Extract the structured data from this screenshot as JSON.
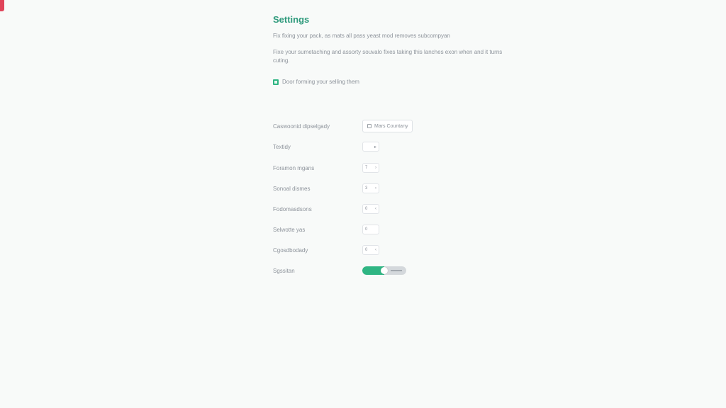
{
  "app": {
    "title": "Settings",
    "accent_color": "#2fb583",
    "title_color": "#2e9a7c"
  },
  "intro": {
    "line1": "Fix fixing your pack, as mats all pass yeast mod removes subcompyan",
    "line2": "Fixe your sumetaching and assorty souvalo fixes taking this lanches exon when and it turns cuting."
  },
  "checkbox": {
    "label": "Door forming your selling them",
    "checked": true
  },
  "rows": [
    {
      "label": "Caswoonid dipselgady",
      "control": "select-button",
      "value": "Mars Countany",
      "icon": "square-icon"
    },
    {
      "label": "Textidy",
      "control": "stepper",
      "value": "",
      "arrow": "▸"
    },
    {
      "label": "Foramon mgans",
      "control": "stepper",
      "value": "7",
      "arrow": "›"
    },
    {
      "label": "Sonoal dismes",
      "control": "stepper",
      "value": "3",
      "arrow": "›"
    },
    {
      "label": "Fodomasdsons",
      "control": "stepper",
      "value": "0",
      "arrow": "‹"
    },
    {
      "label": "Selwotte yas",
      "control": "stepper",
      "value": "0",
      "arrow": ""
    },
    {
      "label": "Cgosdbodady",
      "control": "stepper",
      "value": "0",
      "arrow": "‹"
    },
    {
      "label": "Sgssitan",
      "control": "toggle",
      "value": "on",
      "level": 0.5
    }
  ]
}
